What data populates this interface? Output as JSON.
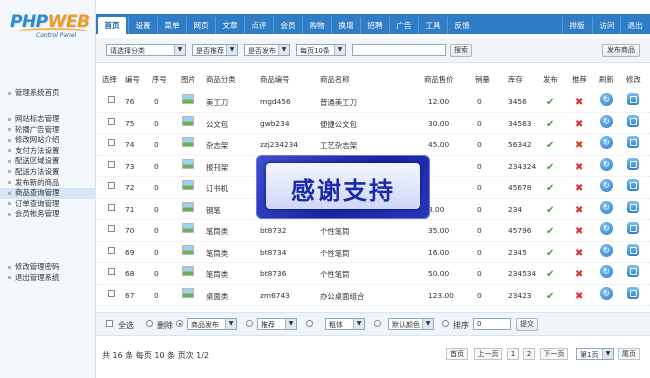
{
  "logo": {
    "brand_a": "PHP",
    "brand_b": "WEB",
    "subtitle": "Control Panel"
  },
  "sidebar": {
    "groups": [
      [
        "管理系统首页"
      ],
      [
        "网站标志管理",
        "轮播广告管理",
        "修改网站介绍",
        "支付方法设置",
        "配送区域设置",
        "配送方法设置",
        "发布新的商品",
        "商品查询管理",
        "订单查询管理",
        "会员帐务管理"
      ],
      [
        "修改管理密码",
        "退出管理系统"
      ]
    ],
    "active": "商品查询管理"
  },
  "topnav": {
    "tabs": [
      "首页",
      "设置",
      "菜单",
      "网页",
      "文章",
      "点评",
      "会员",
      "购物",
      "换增",
      "招聘",
      "广告",
      "工具",
      "反馈"
    ],
    "active": "首页",
    "right": [
      "排版",
      "访问",
      "退出"
    ]
  },
  "filters": {
    "category": "请选择分类",
    "recommend": "是否推荐",
    "publish": "是否发布",
    "per_page": "每页10条",
    "search_value": "",
    "search_btn": "搜索",
    "publish_btn": "发布商品"
  },
  "table": {
    "columns": [
      "选择",
      "编号",
      "序号",
      "图片",
      "商品分类",
      "商品编号",
      "商品名称",
      "商品售价",
      "销量",
      "库存",
      "发布",
      "推荐",
      "刷新",
      "修改"
    ],
    "rows": [
      {
        "id": "76",
        "seq": "0",
        "cat": "美工刀",
        "code": "mgd456",
        "name": "普通美工刀",
        "price": "12.00",
        "sales": "0",
        "stock": "3456",
        "pub": true,
        "rec": false
      },
      {
        "id": "75",
        "seq": "0",
        "cat": "公文包",
        "code": "gwb234",
        "name": "便捷公文包",
        "price": "30.00",
        "sales": "0",
        "stock": "34563",
        "pub": true,
        "rec": false
      },
      {
        "id": "74",
        "seq": "0",
        "cat": "杂志架",
        "code": "zzj234234",
        "name": "工艺杂志架",
        "price": "45.00",
        "sales": "0",
        "stock": "56342",
        "pub": true,
        "rec": false
      },
      {
        "id": "73",
        "seq": "0",
        "cat": "报刊架",
        "code": "",
        "name": "",
        "price": "",
        "sales": "0",
        "stock": "234324",
        "pub": true,
        "rec": false
      },
      {
        "id": "72",
        "seq": "0",
        "cat": "订书机",
        "code": "",
        "name": "",
        "price": "",
        "sales": "0",
        "stock": "45678",
        "pub": true,
        "rec": false
      },
      {
        "id": "71",
        "seq": "0",
        "cat": "钢笔",
        "code": "",
        "name": "",
        "price": "8.00",
        "sales": "0",
        "stock": "234",
        "pub": true,
        "rec": false
      },
      {
        "id": "70",
        "seq": "0",
        "cat": "笔筒类",
        "code": "bt8732",
        "name": "个性笔筒",
        "price": "35.00",
        "sales": "0",
        "stock": "45796",
        "pub": true,
        "rec": false
      },
      {
        "id": "69",
        "seq": "0",
        "cat": "笔筒类",
        "code": "bt8734",
        "name": "个性笔筒",
        "price": "16.00",
        "sales": "0",
        "stock": "2345",
        "pub": true,
        "rec": false
      },
      {
        "id": "68",
        "seq": "0",
        "cat": "笔筒类",
        "code": "bt8736",
        "name": "个性笔筒",
        "price": "50.00",
        "sales": "0",
        "stock": "234534",
        "pub": true,
        "rec": false
      },
      {
        "id": "67",
        "seq": "0",
        "cat": "桌面类",
        "code": "zm6743",
        "name": "办公桌面组合",
        "price": "123.00",
        "sales": "0",
        "stock": "23423",
        "pub": true,
        "rec": false
      }
    ]
  },
  "batch": {
    "select_all": "全选",
    "delete": "删除",
    "publish_sel": "商品发布",
    "recommend_sel": "推荐",
    "bold_sel": "粗体",
    "color_sel": "默认颜色",
    "sort_label": "排序",
    "sort_value": "0",
    "submit": "提交"
  },
  "pagination": {
    "summary": "共 16 条 每页 10 条 页次 1/2",
    "first": "首页",
    "prev": "上一页",
    "pages": [
      "1",
      "2"
    ],
    "next": "下一页",
    "jump": "第1页",
    "last": "尾页"
  },
  "watermark": "感谢支持",
  "colors": {
    "accent": "#2f7cc7",
    "ok": "#3aaa35",
    "no": "#d9342b"
  }
}
